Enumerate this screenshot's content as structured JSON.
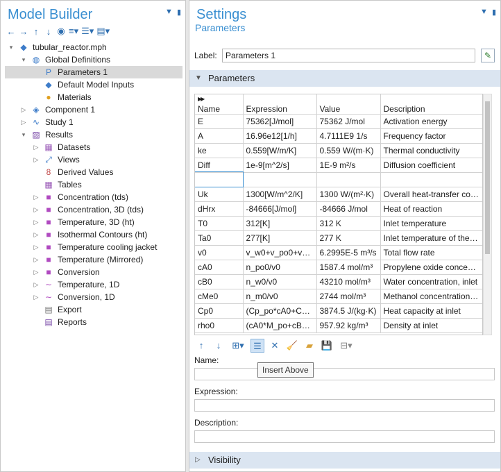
{
  "model_builder": {
    "title": "Model Builder",
    "tree": [
      {
        "label": "tubular_reactor.mph",
        "icon": "model-file-icon",
        "toggle": "▾",
        "level": 0
      },
      {
        "label": "Global Definitions",
        "icon": "globe-icon",
        "toggle": "▾",
        "level": 1
      },
      {
        "label": "Parameters 1",
        "icon": "parameters-icon",
        "toggle": "",
        "level": 2,
        "selected": true
      },
      {
        "label": "Default Model Inputs",
        "icon": "model-inputs-icon",
        "toggle": "",
        "level": 2
      },
      {
        "label": "Materials",
        "icon": "materials-icon",
        "toggle": "",
        "level": 2
      },
      {
        "label": "Component 1",
        "icon": "component-icon",
        "toggle": "▷",
        "level": 1
      },
      {
        "label": "Study 1",
        "icon": "study-icon",
        "toggle": "▷",
        "level": 1
      },
      {
        "label": "Results",
        "icon": "results-icon",
        "toggle": "▾",
        "level": 1
      },
      {
        "label": "Datasets",
        "icon": "datasets-icon",
        "toggle": "▷",
        "level": 2
      },
      {
        "label": "Views",
        "icon": "views-icon",
        "toggle": "▷",
        "level": 2
      },
      {
        "label": "Derived Values",
        "icon": "derived-values-icon",
        "toggle": "",
        "level": 2
      },
      {
        "label": "Tables",
        "icon": "tables-icon",
        "toggle": "",
        "level": 2
      },
      {
        "label": "Concentration (tds)",
        "icon": "plot-group-icon",
        "toggle": "▷",
        "level": 2
      },
      {
        "label": "Concentration, 3D (tds)",
        "icon": "plot-group-icon",
        "toggle": "▷",
        "level": 2
      },
      {
        "label": "Temperature, 3D (ht)",
        "icon": "plot-group-icon",
        "toggle": "▷",
        "level": 2
      },
      {
        "label": "Isothermal Contours (ht)",
        "icon": "plot-group-icon",
        "toggle": "▷",
        "level": 2
      },
      {
        "label": "Temperature cooling jacket",
        "icon": "plot-group-icon",
        "toggle": "▷",
        "level": 2
      },
      {
        "label": "Temperature (Mirrored)",
        "icon": "plot-group-icon",
        "toggle": "▷",
        "level": 2
      },
      {
        "label": "Conversion",
        "icon": "plot-group-icon",
        "toggle": "▷",
        "level": 2
      },
      {
        "label": "Temperature, 1D",
        "icon": "line-plot-icon",
        "toggle": "▷",
        "level": 2
      },
      {
        "label": "Conversion, 1D",
        "icon": "line-plot-icon",
        "toggle": "▷",
        "level": 2
      },
      {
        "label": "Export",
        "icon": "export-icon",
        "toggle": "",
        "level": 2
      },
      {
        "label": "Reports",
        "icon": "reports-icon",
        "toggle": "",
        "level": 2
      }
    ]
  },
  "settings": {
    "title": "Settings",
    "subtitle": "Parameters",
    "label_caption": "Label:",
    "label_value": "Parameters 1",
    "section_parameters": "Parameters",
    "columns": [
      "Name",
      "Expression",
      "Value",
      "Description"
    ],
    "rows": [
      [
        "E",
        "75362[J/mol]",
        "75362 J/mol",
        "Activation energy"
      ],
      [
        "A",
        "16.96e12[1/h]",
        "4.7111E9 1/s",
        "Frequency factor"
      ],
      [
        "ke",
        "0.559[W/m/K]",
        "0.559 W/(m·K)",
        "Thermal conductivity"
      ],
      [
        "Diff",
        "1e-9[m^2/s]",
        "1E-9 m²/s",
        "Diffusion coefficient"
      ],
      [
        "",
        "",
        "",
        ""
      ],
      [
        "Uk",
        "1300[W/m^2/K]",
        "1300 W/(m²·K)",
        "Overall heat-transfer coef..."
      ],
      [
        "dHrx",
        "-84666[J/mol]",
        "-84666 J/mol",
        "Heat of reaction"
      ],
      [
        "T0",
        "312[K]",
        "312 K",
        "Inlet temperature"
      ],
      [
        "Ta0",
        "277[K]",
        "277 K",
        "Inlet temperature of the c..."
      ],
      [
        "v0",
        "v_w0+v_po0+v_...",
        "6.2995E-5 m³/s",
        "Total flow rate"
      ],
      [
        "cA0",
        "n_po0/v0",
        "1587.4 mol/m³",
        "Propylene oxide concent..."
      ],
      [
        "cB0",
        "n_w0/v0",
        "43210 mol/m³",
        "Water concentration, inlet"
      ],
      [
        "cMe0",
        "n_m0/v0",
        "2744 mol/m³",
        "Methanol concentration,..."
      ],
      [
        "Cp0",
        "(Cp_po*cA0+Cp...",
        "3874.5 J/(kg·K)",
        "Heat capacity at inlet"
      ],
      [
        "rho0",
        "(cA0*M_po+cB0...",
        "957.92 kg/m³",
        "Density at inlet"
      ]
    ],
    "tooltip": "Insert Above",
    "name_label": "Name:",
    "expression_label": "Expression:",
    "description_label": "Description:",
    "section_visibility": "Visibility"
  }
}
